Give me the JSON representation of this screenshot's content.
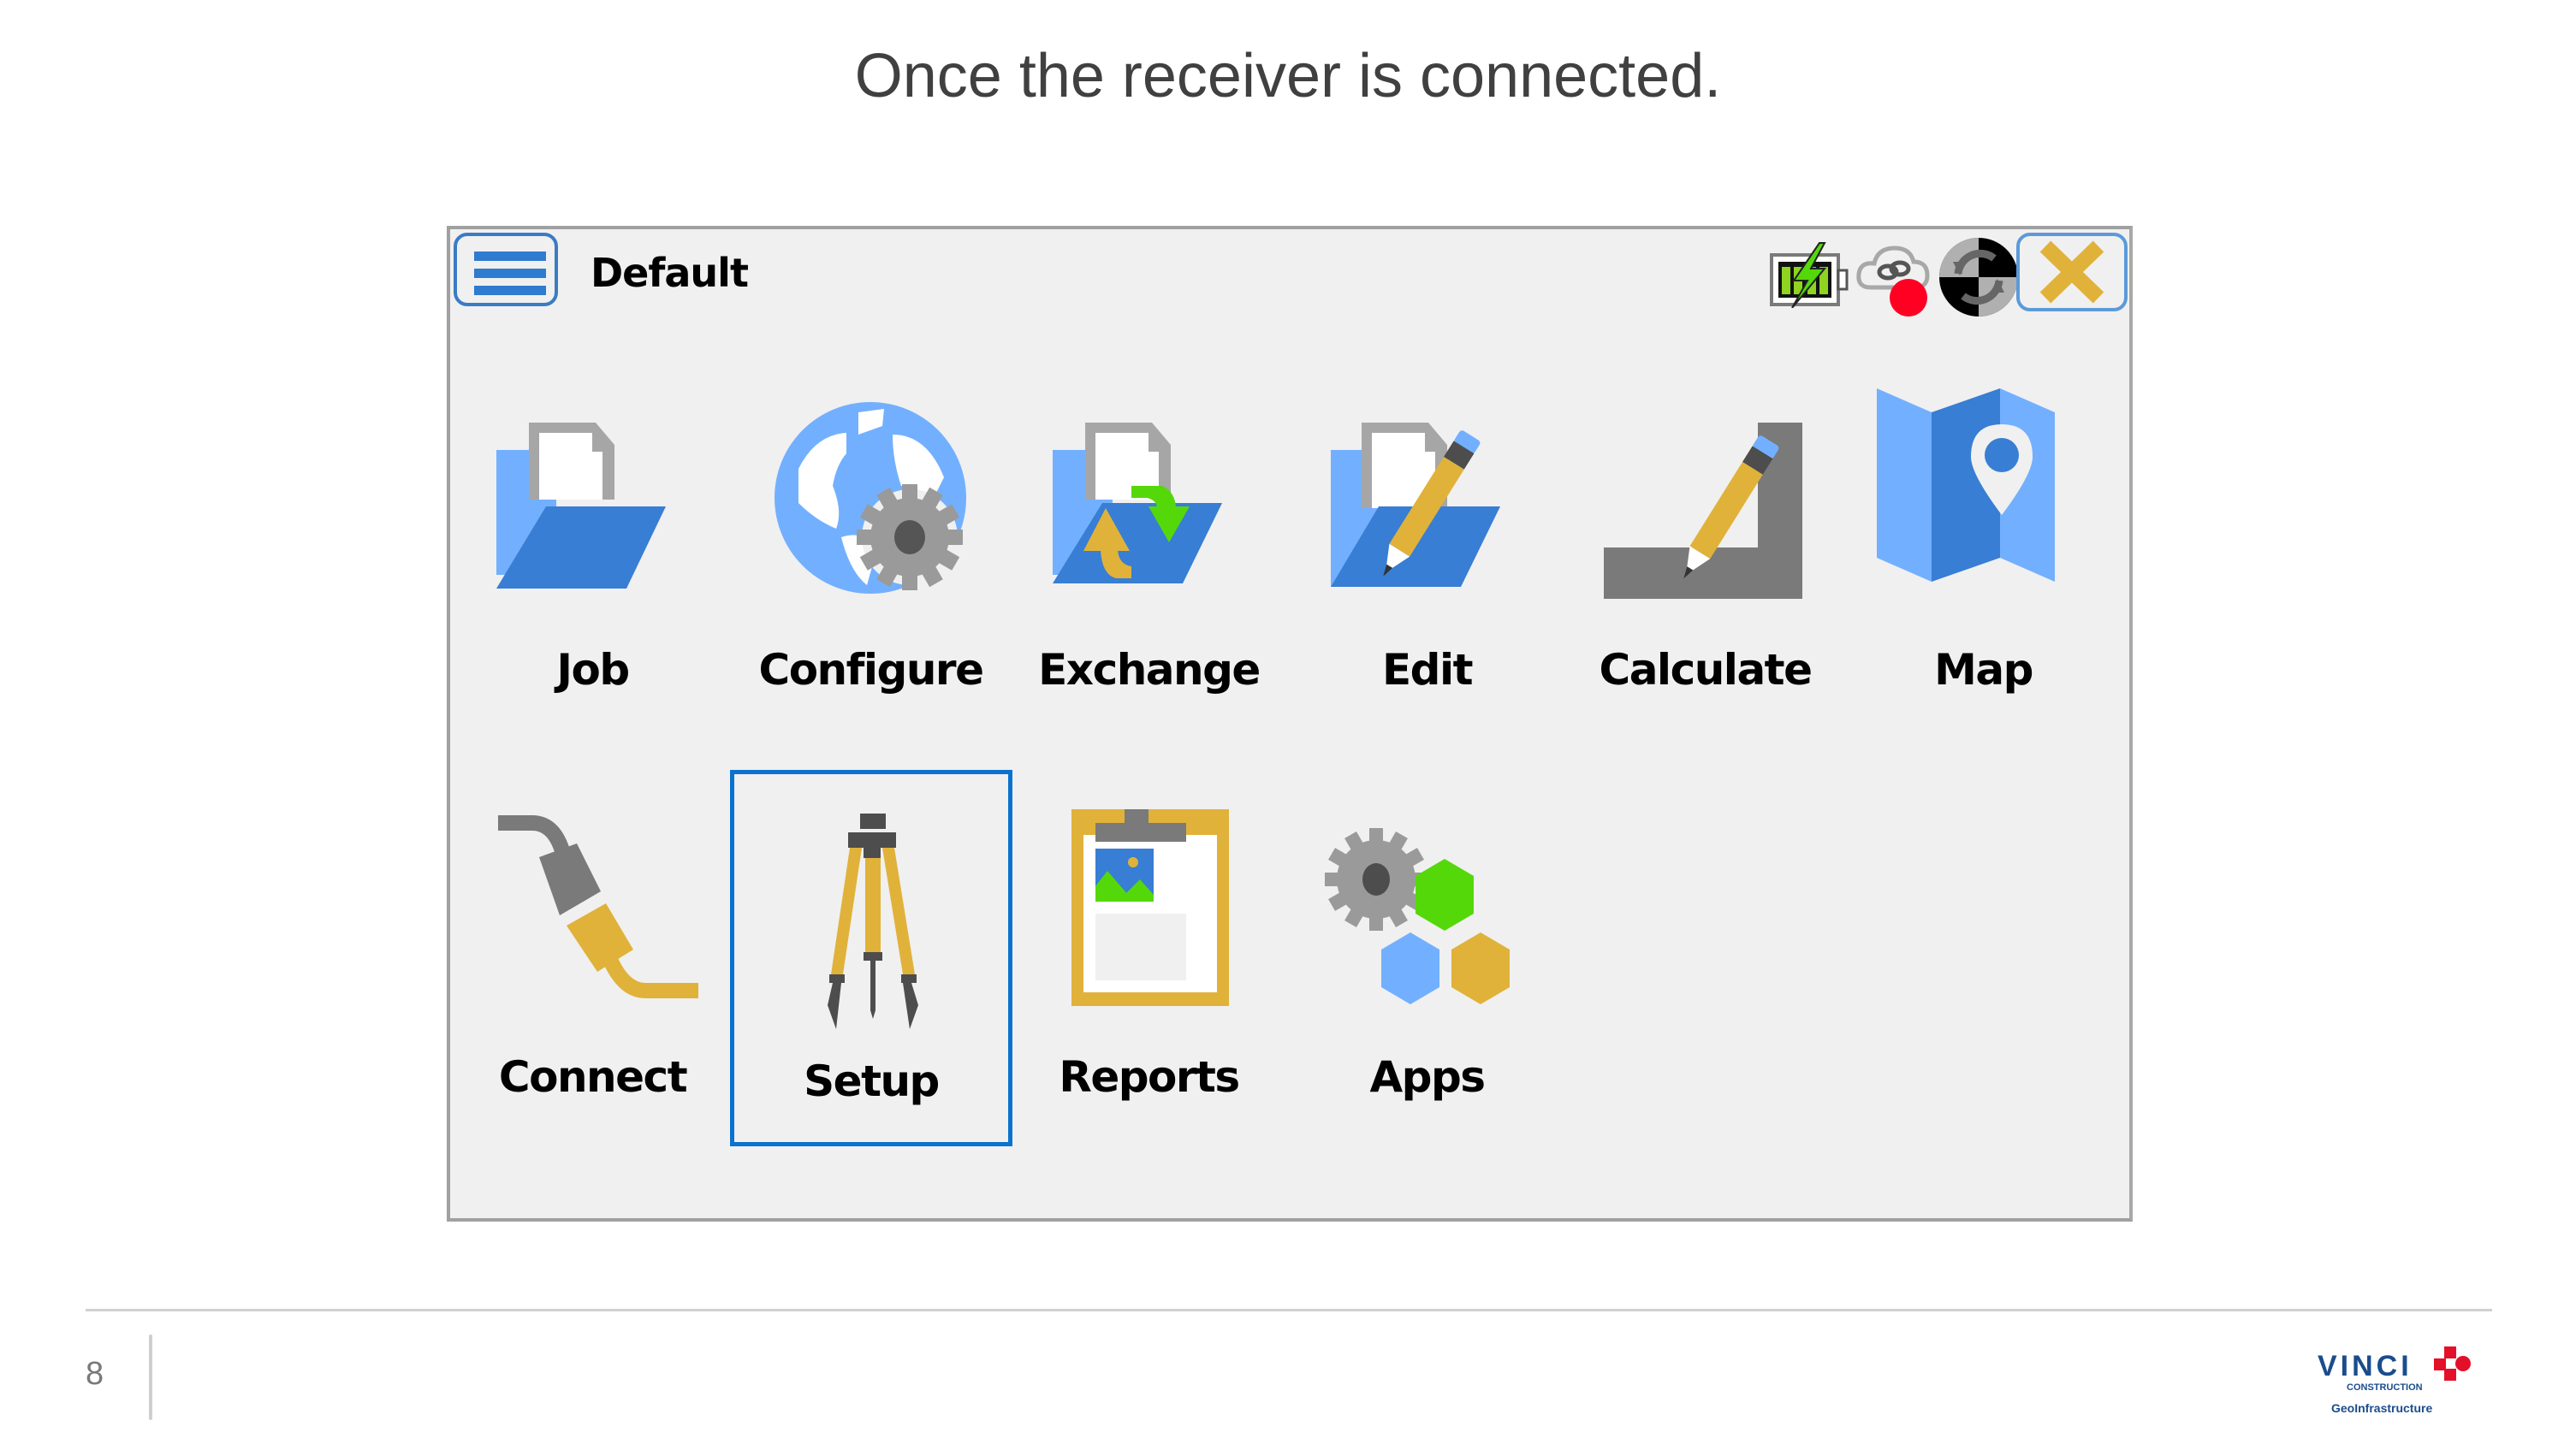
{
  "slide": {
    "title": "Once the receiver is connected.",
    "page_number": "8"
  },
  "header": {
    "job_name": "Default",
    "menu_icon": "hamburger-menu-icon",
    "status_icons": [
      "battery-charging-icon",
      "cloud-link-icon",
      "rtk-status-icon"
    ],
    "status_dot_color": "#ff0022",
    "close_icon": "close-x-icon"
  },
  "tiles": [
    {
      "label": "Job",
      "icon": "folder-document-icon"
    },
    {
      "label": "Configure",
      "icon": "globe-gear-icon"
    },
    {
      "label": "Exchange",
      "icon": "folder-exchange-icon"
    },
    {
      "label": "Edit",
      "icon": "folder-pencil-icon"
    },
    {
      "label": "Calculate",
      "icon": "square-pencil-icon"
    },
    {
      "label": "Map",
      "icon": "map-pin-icon"
    },
    {
      "label": "Connect",
      "icon": "plug-icon"
    },
    {
      "label": "Setup",
      "icon": "tripod-icon",
      "focused": true
    },
    {
      "label": "Reports",
      "icon": "clipboard-report-icon"
    },
    {
      "label": "Apps",
      "icon": "gear-hexagons-icon"
    }
  ],
  "colors": {
    "accent_blue": "#3a7ed4",
    "light_blue": "#72b0ff",
    "gold": "#e0b23a",
    "green": "#55d80a",
    "gray": "#7a7a7a",
    "focus_border": "#0a72cf"
  },
  "logo": {
    "brand": "VINCI",
    "sub": "CONSTRUCTION",
    "division": "GeoInfrastructure"
  }
}
